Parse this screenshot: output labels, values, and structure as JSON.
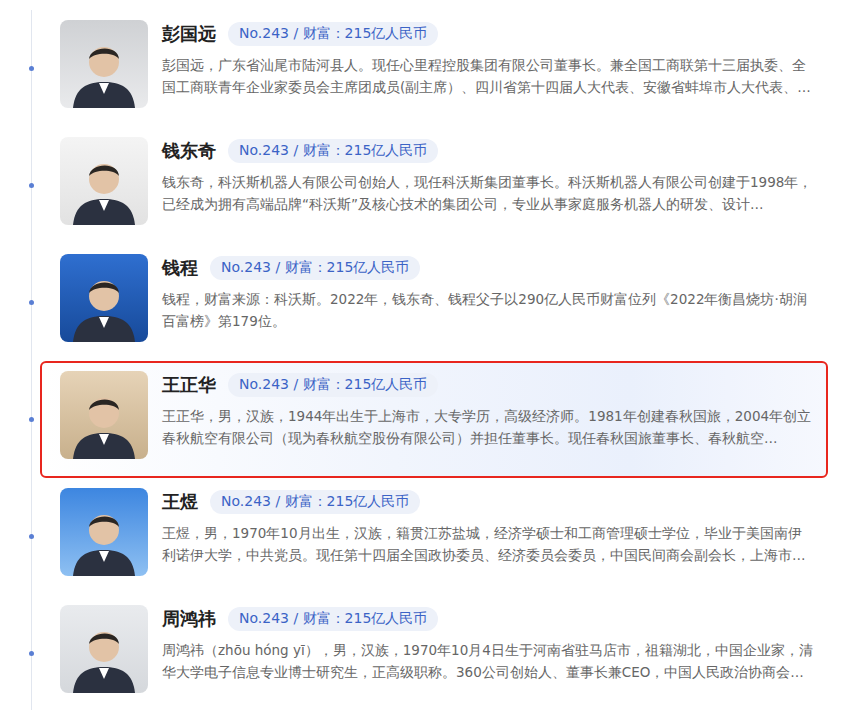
{
  "people": [
    {
      "name": "彭国远",
      "badge": "No.243 / 财富：215亿人民币",
      "description": "彭国远，广东省汕尾市陆河县人。现任心里程控股集团有限公司董事长。兼全国工商联第十三届执委、全国工商联青年企业家委员会主席团成员(副主席）、四川省第十四届人大代表、安徽省蚌埠市人大代表、…",
      "highlighted": false
    },
    {
      "name": "钱东奇",
      "badge": "No.243 / 财富：215亿人民币",
      "description": "钱东奇，科沃斯机器人有限公司创始人，现任科沃斯集团董事长。科沃斯机器人有限公司创建于1998年，已经成为拥有高端品牌“科沃斯”及核心技术的集团公司，专业从事家庭服务机器人的研发、设计…",
      "highlighted": false
    },
    {
      "name": "钱程",
      "badge": "No.243 / 财富：215亿人民币",
      "description": "钱程，财富来源：科沃斯。2022年，钱东奇、钱程父子以290亿人民币财富位列《2022年衡昌烧坊·胡润百富榜》第179位。",
      "highlighted": false
    },
    {
      "name": "王正华",
      "badge": "No.243 / 财富：215亿人民币",
      "description": "王正华，男，汉族，1944年出生于上海市，大专学历，高级经济师。1981年创建春秋国旅，2004年创立春秋航空有限公司（现为春秋航空股份有限公司）并担任董事长。现任春秋国旅董事长、春秋航空…",
      "highlighted": true
    },
    {
      "name": "王煜",
      "badge": "No.243 / 财富：215亿人民币",
      "description": "王煜，男，1970年10月出生，汉族，籍贯江苏盐城，经济学硕士和工商管理硕士学位，毕业于美国南伊利诺伊大学，中共党员。现任第十四届全国政协委员、经济委员会委员，中国民间商会副会长，上海市…",
      "highlighted": false
    },
    {
      "name": "周鸿祎",
      "badge": "No.243 / 财富：215亿人民币",
      "description": "周鸿祎（zhōu hóng yī），男，汉族，1970年10月4日生于河南省驻马店市，祖籍湖北，中国企业家，清华大学电子信息专业博士研究生，正高级职称。360公司创始人、董事长兼CEO，中国人民政治协商会…",
      "highlighted": false
    }
  ]
}
